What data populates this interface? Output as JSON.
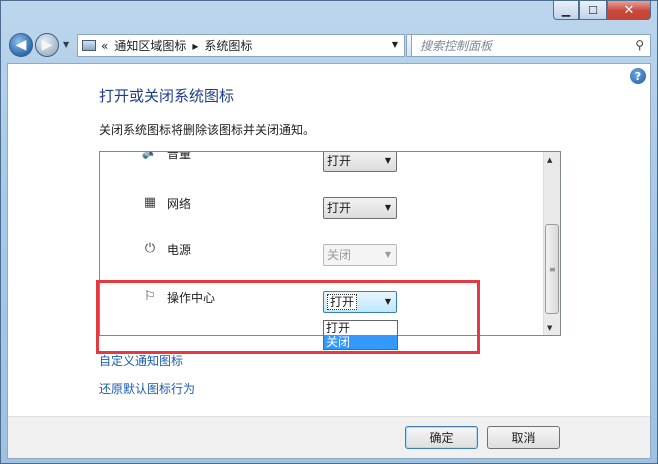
{
  "window": {
    "caption": {
      "minimize": "▁",
      "maximize": "☐",
      "close": "✕"
    }
  },
  "navbar": {
    "address": {
      "chevrons": "«",
      "crumb1": "通知区域图标",
      "separator": "▸",
      "crumb2": "系统图标"
    },
    "search_placeholder": "搜索控制面板"
  },
  "content": {
    "help": "?",
    "title": "打开或关闭系统图标",
    "subtitle": "关闭系统图标将删除该图标并关闭通知。",
    "rows": [
      {
        "icon": "volume-icon",
        "label": "音量",
        "value": "打开",
        "enabled": true
      },
      {
        "icon": "network-icon",
        "label": "网络",
        "value": "打开",
        "enabled": true
      },
      {
        "icon": "power-icon",
        "label": "电源",
        "value": "关闭",
        "enabled": false
      },
      {
        "icon": "flag-icon",
        "label": "操作中心",
        "value": "打开",
        "enabled": true
      }
    ],
    "dropdown_options": [
      "打开",
      "关闭"
    ],
    "dropdown_selected": "关闭",
    "link_customize": "自定义通知图标",
    "link_restore": "还原默认图标行为"
  },
  "footer": {
    "ok": "确定",
    "cancel": "取消"
  },
  "colors": {
    "title": "#1e3d8f",
    "link": "#1a5cb0",
    "highlight": "#e23a40",
    "selection": "#3399ff"
  }
}
